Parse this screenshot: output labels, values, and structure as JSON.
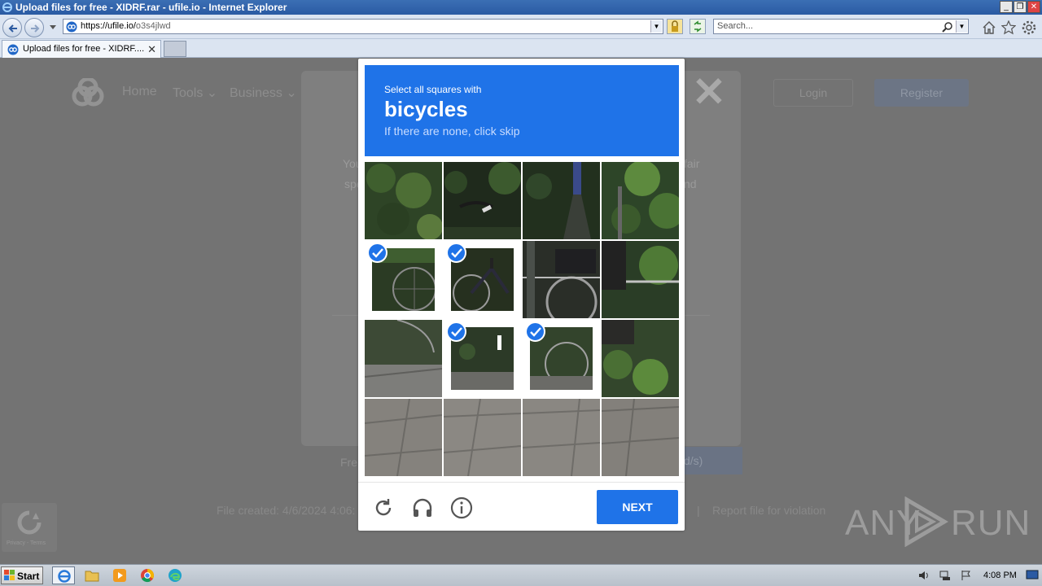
{
  "window": {
    "title": "Upload files for free - XIDRF.rar - ufile.io - Internet Explorer",
    "controls": {
      "minimize": "_",
      "restore": "❐",
      "close": "✕"
    }
  },
  "browser": {
    "url_host": "https://ufile.io/",
    "url_path": "o3s4jlwd",
    "search_placeholder": "Search...",
    "tab_title": "Upload files for free - XIDRF....",
    "tab_close": "✕"
  },
  "site": {
    "nav": [
      "Home",
      "Tools ⌄",
      "Business ⌄"
    ],
    "login": "Login",
    "register": "Register",
    "modal_close": "✕",
    "modal_text_left": [
      "You",
      "spe"
    ],
    "modal_text_right": [
      "fair",
      "nd"
    ],
    "free_label": "Fre",
    "speed_btn": "d/s)",
    "file_created": "File created: 4/6/2024 4:06:",
    "separator": "|",
    "report": "Report file for violation",
    "recaptcha_badge": "Privacy - Terms"
  },
  "captcha": {
    "instruction": "Select all squares with",
    "target": "bicycles",
    "hint": "If there are none, click skip",
    "next_label": "NEXT",
    "tiles_selected": [
      false,
      false,
      false,
      false,
      true,
      true,
      false,
      false,
      false,
      true,
      true,
      false,
      false,
      false,
      false,
      false
    ]
  },
  "watermark": {
    "text": "ANY",
    "text2": "RUN"
  },
  "taskbar": {
    "start_label": "Start",
    "clock": "4:08 PM"
  },
  "colors": {
    "captcha_blue": "#1f73e8",
    "overlay": "#737373"
  }
}
